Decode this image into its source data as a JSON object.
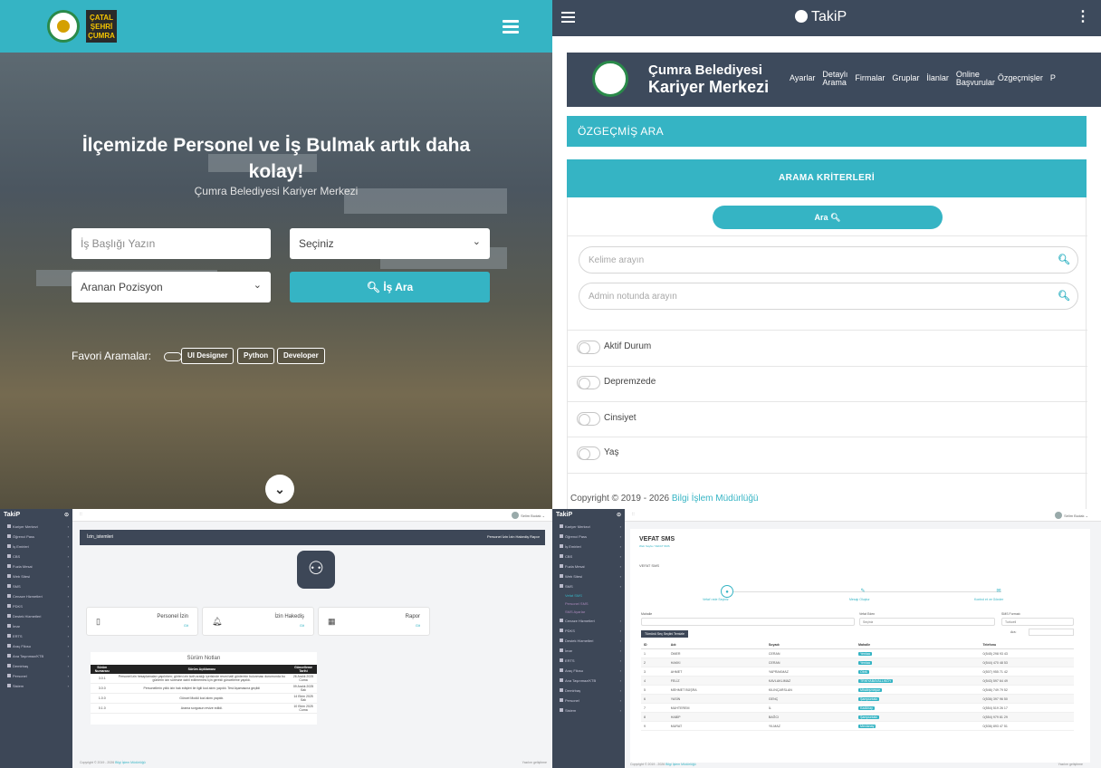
{
  "q1": {
    "logo_text": "ÇATALHÖYÜK ŞEHRİ ÇUMRA",
    "hero_title": "İlçemizde Personel ve İş Bulmak artık daha kolay!",
    "hero_subtitle": "Çumra Belediyesi Kariyer Merkezi",
    "job_title_placeholder": "İş Başlığı Yazın",
    "select_label": "Seçiniz",
    "position_label": "Aranan Pozisyon",
    "search_button": "İş Ara",
    "favorites_label": "Favori Aramalar:",
    "tags": [
      "UI Designer",
      "Python",
      "Developer"
    ]
  },
  "q2": {
    "app_title": "TakiP",
    "brand_line1": "Çumra Belediyesi",
    "brand_line2": "Kariyer Merkezi",
    "nav": [
      "Ayarlar",
      "Detaylı Arama",
      "Firmalar",
      "Gruplar",
      "İlanlar",
      "Online Başvurular",
      "Özgeçmişler",
      "P"
    ],
    "section_title": "ÖZGEÇMİŞ ARA",
    "criteria_title": "ARAMA KRİTERLERİ",
    "search_button": "Ara",
    "keyword_placeholder": "Kelime arayın",
    "admin_note_placeholder": "Admin notunda arayın",
    "toggles": [
      "Aktif Durum",
      "Depremzede",
      "Cinsiyet",
      "Yaş"
    ],
    "copyright": "Copyright © 2019 - 2026",
    "copyright_org": "Bilgi İşlem Müdürlüğü"
  },
  "sidebar": {
    "brand": "TakiP",
    "items": [
      "Kariyer Merkezi",
      "Öğrenci Pass",
      "İş Emirleri",
      "CBS",
      "Fuzla Mesai",
      "Web Sitesi",
      "SMS",
      "Cenaze Hizmetleri",
      "PDKS",
      "Destek Hizmetleri",
      "İmar",
      "ERTS",
      "Araç Filosu",
      "Ana Taşınmaz/KTB",
      "Demirbaş",
      "Personel",
      "Sistem"
    ],
    "sms_sub": [
      "Vefat SMS",
      "Personel SMS",
      "SMS Ayarlar"
    ]
  },
  "q3": {
    "user": "Selim Budak",
    "header": "İzin_istemleri",
    "header_links": "Personel İzin   İzin Hakediş   Rapor",
    "cards": [
      {
        "icon": "document-icon",
        "title": "Personel İzin",
        "go": "Git"
      },
      {
        "icon": "bell-icon",
        "title": "İzin Hakediş",
        "go": "Git"
      },
      {
        "icon": "table-icon",
        "title": "Rapor",
        "go": "Git"
      }
    ],
    "notes_title": "Sürüm Notları",
    "notes_headers": [
      "Sürüm Numarası",
      "Sürüm Açıklaması",
      "Güncelleme Tarihi"
    ],
    "notes_rows": [
      [
        "3.0.1",
        "Personel izin hesaplamaları yapılırken; görlen izin tarih aralığı içerisinde resmi tatil günlerinin bulunması durumunda bu günlerin izin süresine dahil edilmemesi için gerekli güncelleme yapıldı.",
        "26 Aralık 2025 Cuma"
      ],
      [
        "3.0.0",
        "Personellerin yıllık izin hak edişleri ile ilgili kod alımı yapıldı. Test Aşamasına geçildi",
        "09 Aralık 2025 Salı"
      ],
      [
        "1.0.0",
        "Güncel Modül kod alımı yapıldı.",
        "14 Ekim 2025 Salı"
      ],
      [
        "0.1.0",
        "Arama sorgusun revize edildi.",
        "10 Ekim 2025 Cuma"
      ]
    ],
    "footer": "Copyright © 2019 - 2026",
    "footer_org": "Bilgi İşlem Müdürlüğü",
    "footer_right": "Yazılım geliştirme"
  },
  "q4": {
    "user": "Selim Budak",
    "page_title": "VEFAT SMS",
    "breadcrumb": "Web Sayfa  /  VEFAT SMS",
    "card_title": "VEFAT SMS",
    "steps": [
      "Vefat'ı ede Seçiniz",
      "Mesajı Oluştur",
      "Kontrol et ve Gönder"
    ],
    "label_mahalle": "Mahalle",
    "label_vefat": "Vefat Eden",
    "vefat_select": "Seçiniz",
    "label_format": "SMS Formatı",
    "format_value": "Turkcell",
    "buttons": "Tümünü Seç   Seçilni Temizle",
    "search_label": "Ara:",
    "columns": [
      "ID",
      "Adı",
      "Soyadı",
      "Mahalle",
      "Telefonu"
    ],
    "rows": [
      [
        "1",
        "ÖMER",
        "CERAN",
        "Yeniaa",
        "0(545) 298 93 43"
      ],
      [
        "2",
        "HAKKI",
        "CERAN",
        "Yeniaa",
        "0(544) 470 48 53"
      ],
      [
        "3",
        "AHMET",
        "YAPRAKMAZ",
        "Obrk",
        "0(507) 955 71 42"
      ],
      [
        "4",
        "FELİZ",
        "KAVLAKLIMAZ",
        "TRİKYABAYALLIKÖY",
        "0(543) 597 64 49"
      ],
      [
        "5",
        "MEHMET BÜŞRA",
        "KILINÇARSLAN",
        "Mhaleşmeşse",
        "0(546) 749 79 52"
      ],
      [
        "6",
        "YASİN",
        "GENÇ",
        "Şampuntakı",
        "0(536) 397 96 50"
      ],
      [
        "7",
        "MUHTEREM",
        "İL",
        "Kadkhay",
        "0(554) 519 26 17"
      ],
      [
        "8",
        "HABİP",
        "BAĞCI",
        "Şampuntakı",
        "0(554) 979 81 29"
      ],
      [
        "9",
        "MURAT",
        "YILMAZ",
        "Mevlanay",
        "0(536) 893 47 51"
      ]
    ],
    "footer": "Copyright © 2019 - 2026",
    "footer_org": "Bilgi İşlem Müdürlüğü",
    "footer_right": "Yazılım geliştirme"
  },
  "colors": {
    "accent": "#35b4c4",
    "dark": "#3d4757"
  }
}
